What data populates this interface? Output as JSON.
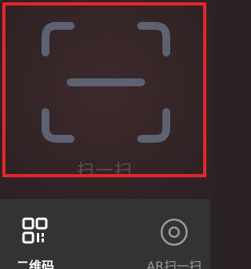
{
  "scanner": {
    "caption": "扫一扫"
  },
  "tabs": [
    {
      "label": "二维码",
      "icon": "qr-code-icon",
      "selected": true
    },
    {
      "label": "AR扫一扫",
      "icon": "ar-scan-icon",
      "selected": false
    }
  ],
  "colors": {
    "highlight": "#e8262a",
    "frame": "#5c6272",
    "bar_bg": "#333334",
    "active_label": "#ffffff",
    "inactive_label": "#9a9a9a"
  }
}
